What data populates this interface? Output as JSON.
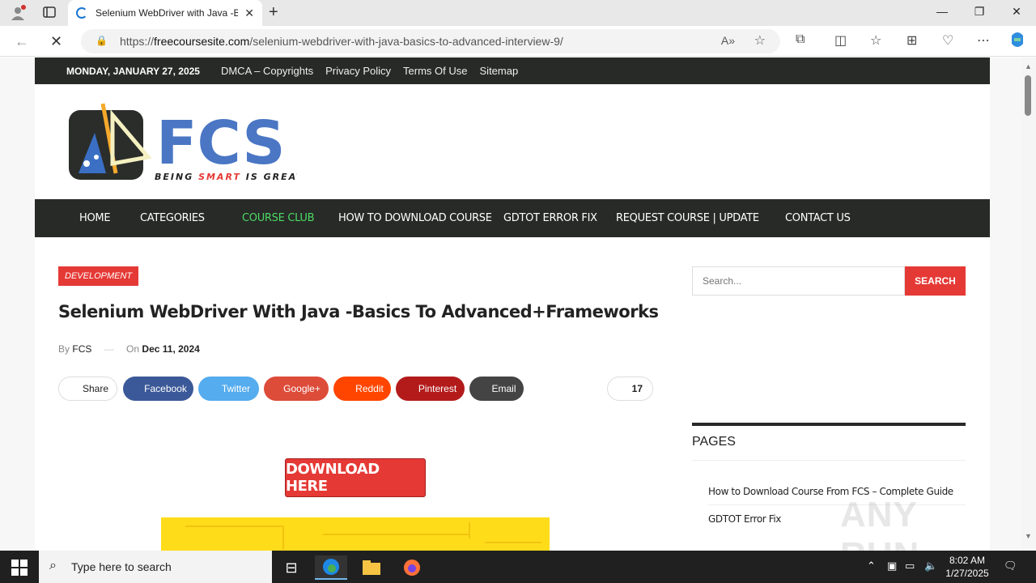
{
  "browser": {
    "tab_title": "Selenium WebDriver with Java -B",
    "url_host": "freecoursesite.com",
    "url_scheme": "https://",
    "url_path": "/selenium-webdriver-with-java-basics-to-advanced-interview-9/"
  },
  "topbar": {
    "date": "MONDAY, JANUARY 27, 2025",
    "links": [
      "DMCA – Copyrights",
      "Privacy Policy",
      "Terms Of Use",
      "Sitemap"
    ]
  },
  "logo": {
    "letters": "FCS",
    "tagline_1": "BEING ",
    "tagline_2": "SMART",
    "tagline_3": " IS GREAT"
  },
  "nav": [
    "HOME",
    "CATEGORIES",
    "COURSE CLUB",
    "HOW TO DOWNLOAD COURSE",
    "GDTOT ERROR FIX",
    "REQUEST COURSE | UPDATE",
    "CONTACT US"
  ],
  "post": {
    "category": "DEVELOPMENT",
    "title": "Selenium WebDriver With Java -Basics To Advanced+Frameworks",
    "by": "By",
    "author": "FCS",
    "on": "On",
    "date": "Dec 11, 2024",
    "share_label": "Share",
    "share_buttons": [
      "Facebook",
      "Twitter",
      "Google+",
      "Reddit",
      "Pinterest",
      "Email"
    ],
    "share_count": "17",
    "download_label": "DOWNLOAD HERE"
  },
  "sidebar": {
    "search_placeholder": "Search...",
    "search_button": "SEARCH",
    "pages_title": "PAGES",
    "pages": [
      "How to Download Course From FCS – Complete Guide",
      "GDTOT Error Fix"
    ]
  },
  "watermark": "ANY RUN",
  "taskbar": {
    "search_placeholder": "Type here to search",
    "time": "8:02 AM",
    "date": "1/27/2025"
  },
  "colors": {
    "accent_red": "#e53935",
    "dark_bar": "#272a27",
    "active_nav": "#4cd964",
    "facebook": "#3b5998",
    "twitter": "#55acee",
    "google": "#dd4b39",
    "reddit": "#ff4500",
    "pinterest": "#b31b1b",
    "email": "#444444"
  }
}
